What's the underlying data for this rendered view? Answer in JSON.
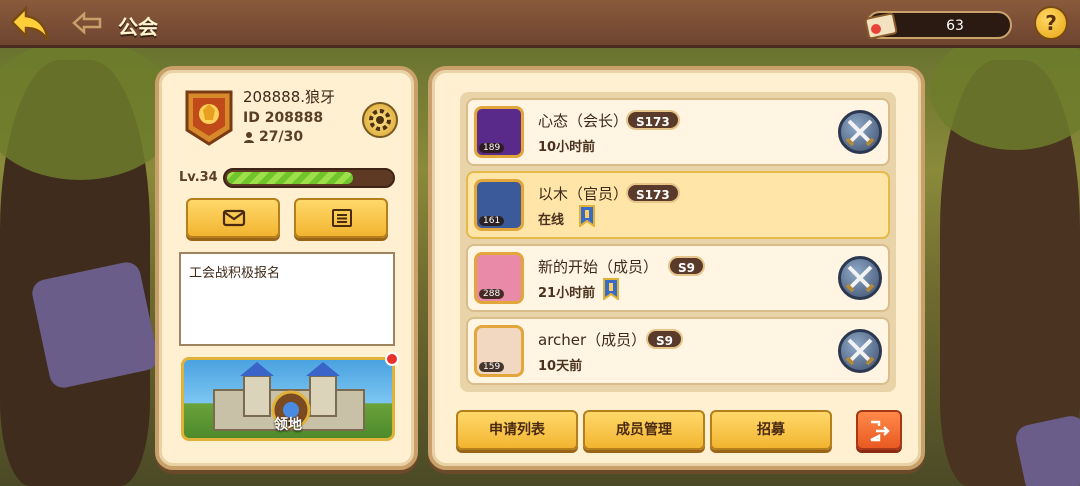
{
  "header": {
    "title": "公会",
    "currency_value": "63"
  },
  "guild": {
    "name": "208888.狼牙",
    "id_text": "ID 208888",
    "members_text": "27/30",
    "level_text": "Lv.34",
    "xp_fraction": 0.77,
    "announcement": "工会战积极报名",
    "territory_label": "领地"
  },
  "members": [
    {
      "name": "心态（会长）",
      "server": "S173",
      "status": "10小时前",
      "avatar_level": "189",
      "has_flag": false,
      "highlight": false
    },
    {
      "name": "以木（官员）",
      "server": "S173",
      "status": "在线",
      "avatar_level": "161",
      "has_flag": true,
      "highlight": true
    },
    {
      "name": "新的开始（成员）",
      "server": "S9",
      "status": "21小时前",
      "avatar_level": "288",
      "has_flag": true,
      "highlight": false
    },
    {
      "name": "archer（成员）",
      "server": "S9",
      "status": "10天前",
      "avatar_level": "159",
      "has_flag": false,
      "highlight": false
    }
  ],
  "actions": {
    "apply_list": "申请列表",
    "member_manage": "成员管理",
    "recruit": "招募"
  },
  "icons": [
    "back-arrow-icon",
    "title-ornament-icon",
    "ticket-icon",
    "help-icon",
    "lion-emblem-icon",
    "settings-icon",
    "mail-icon",
    "notice-list-icon",
    "battle-swords-icon",
    "rank-flag-icon",
    "exit-icon"
  ],
  "colors": {
    "accent": "#f2b430",
    "exit": "#e85a22",
    "xp": "#6fc52b"
  }
}
